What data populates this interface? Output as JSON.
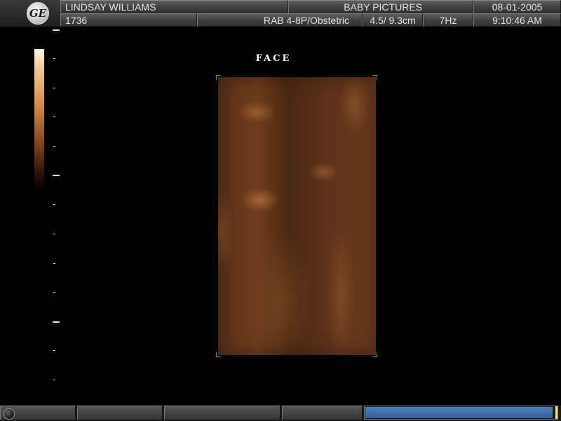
{
  "header": {
    "patient_name": "LINDSAY WILLIAMS",
    "study_title": "BABY PICTURES",
    "date": "08-01-2005",
    "patient_id": "1736",
    "probe_preset": "RAB 4-8P/Obstetric",
    "depth": "4.5/ 9.3cm",
    "frame_rate": "7Hz",
    "time": "9:10:46 AM",
    "logo_text": "GE"
  },
  "image": {
    "label": "FACE"
  },
  "colors": {
    "roi_corner": "#2fa83a",
    "progress_fill": "#3f6fa8",
    "progress_end": "#f0e26a"
  },
  "footer": {
    "progress_fraction": 0.99
  }
}
